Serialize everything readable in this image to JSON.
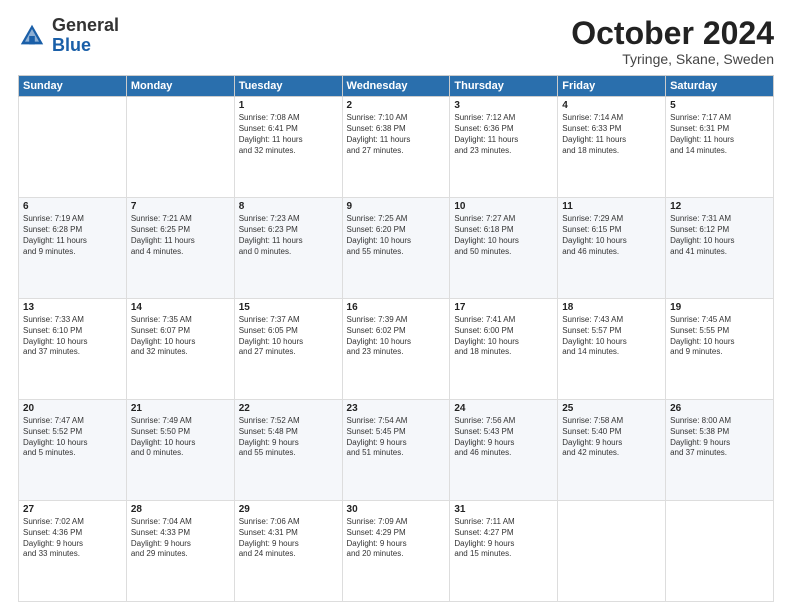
{
  "logo": {
    "general": "General",
    "blue": "Blue"
  },
  "header": {
    "month": "October 2024",
    "location": "Tyringe, Skane, Sweden"
  },
  "weekdays": [
    "Sunday",
    "Monday",
    "Tuesday",
    "Wednesday",
    "Thursday",
    "Friday",
    "Saturday"
  ],
  "weeks": [
    [
      {
        "day": "",
        "content": ""
      },
      {
        "day": "",
        "content": ""
      },
      {
        "day": "1",
        "content": "Sunrise: 7:08 AM\nSunset: 6:41 PM\nDaylight: 11 hours\nand 32 minutes."
      },
      {
        "day": "2",
        "content": "Sunrise: 7:10 AM\nSunset: 6:38 PM\nDaylight: 11 hours\nand 27 minutes."
      },
      {
        "day": "3",
        "content": "Sunrise: 7:12 AM\nSunset: 6:36 PM\nDaylight: 11 hours\nand 23 minutes."
      },
      {
        "day": "4",
        "content": "Sunrise: 7:14 AM\nSunset: 6:33 PM\nDaylight: 11 hours\nand 18 minutes."
      },
      {
        "day": "5",
        "content": "Sunrise: 7:17 AM\nSunset: 6:31 PM\nDaylight: 11 hours\nand 14 minutes."
      }
    ],
    [
      {
        "day": "6",
        "content": "Sunrise: 7:19 AM\nSunset: 6:28 PM\nDaylight: 11 hours\nand 9 minutes."
      },
      {
        "day": "7",
        "content": "Sunrise: 7:21 AM\nSunset: 6:25 PM\nDaylight: 11 hours\nand 4 minutes."
      },
      {
        "day": "8",
        "content": "Sunrise: 7:23 AM\nSunset: 6:23 PM\nDaylight: 11 hours\nand 0 minutes."
      },
      {
        "day": "9",
        "content": "Sunrise: 7:25 AM\nSunset: 6:20 PM\nDaylight: 10 hours\nand 55 minutes."
      },
      {
        "day": "10",
        "content": "Sunrise: 7:27 AM\nSunset: 6:18 PM\nDaylight: 10 hours\nand 50 minutes."
      },
      {
        "day": "11",
        "content": "Sunrise: 7:29 AM\nSunset: 6:15 PM\nDaylight: 10 hours\nand 46 minutes."
      },
      {
        "day": "12",
        "content": "Sunrise: 7:31 AM\nSunset: 6:12 PM\nDaylight: 10 hours\nand 41 minutes."
      }
    ],
    [
      {
        "day": "13",
        "content": "Sunrise: 7:33 AM\nSunset: 6:10 PM\nDaylight: 10 hours\nand 37 minutes."
      },
      {
        "day": "14",
        "content": "Sunrise: 7:35 AM\nSunset: 6:07 PM\nDaylight: 10 hours\nand 32 minutes."
      },
      {
        "day": "15",
        "content": "Sunrise: 7:37 AM\nSunset: 6:05 PM\nDaylight: 10 hours\nand 27 minutes."
      },
      {
        "day": "16",
        "content": "Sunrise: 7:39 AM\nSunset: 6:02 PM\nDaylight: 10 hours\nand 23 minutes."
      },
      {
        "day": "17",
        "content": "Sunrise: 7:41 AM\nSunset: 6:00 PM\nDaylight: 10 hours\nand 18 minutes."
      },
      {
        "day": "18",
        "content": "Sunrise: 7:43 AM\nSunset: 5:57 PM\nDaylight: 10 hours\nand 14 minutes."
      },
      {
        "day": "19",
        "content": "Sunrise: 7:45 AM\nSunset: 5:55 PM\nDaylight: 10 hours\nand 9 minutes."
      }
    ],
    [
      {
        "day": "20",
        "content": "Sunrise: 7:47 AM\nSunset: 5:52 PM\nDaylight: 10 hours\nand 5 minutes."
      },
      {
        "day": "21",
        "content": "Sunrise: 7:49 AM\nSunset: 5:50 PM\nDaylight: 10 hours\nand 0 minutes."
      },
      {
        "day": "22",
        "content": "Sunrise: 7:52 AM\nSunset: 5:48 PM\nDaylight: 9 hours\nand 55 minutes."
      },
      {
        "day": "23",
        "content": "Sunrise: 7:54 AM\nSunset: 5:45 PM\nDaylight: 9 hours\nand 51 minutes."
      },
      {
        "day": "24",
        "content": "Sunrise: 7:56 AM\nSunset: 5:43 PM\nDaylight: 9 hours\nand 46 minutes."
      },
      {
        "day": "25",
        "content": "Sunrise: 7:58 AM\nSunset: 5:40 PM\nDaylight: 9 hours\nand 42 minutes."
      },
      {
        "day": "26",
        "content": "Sunrise: 8:00 AM\nSunset: 5:38 PM\nDaylight: 9 hours\nand 37 minutes."
      }
    ],
    [
      {
        "day": "27",
        "content": "Sunrise: 7:02 AM\nSunset: 4:36 PM\nDaylight: 9 hours\nand 33 minutes."
      },
      {
        "day": "28",
        "content": "Sunrise: 7:04 AM\nSunset: 4:33 PM\nDaylight: 9 hours\nand 29 minutes."
      },
      {
        "day": "29",
        "content": "Sunrise: 7:06 AM\nSunset: 4:31 PM\nDaylight: 9 hours\nand 24 minutes."
      },
      {
        "day": "30",
        "content": "Sunrise: 7:09 AM\nSunset: 4:29 PM\nDaylight: 9 hours\nand 20 minutes."
      },
      {
        "day": "31",
        "content": "Sunrise: 7:11 AM\nSunset: 4:27 PM\nDaylight: 9 hours\nand 15 minutes."
      },
      {
        "day": "",
        "content": ""
      },
      {
        "day": "",
        "content": ""
      }
    ]
  ]
}
